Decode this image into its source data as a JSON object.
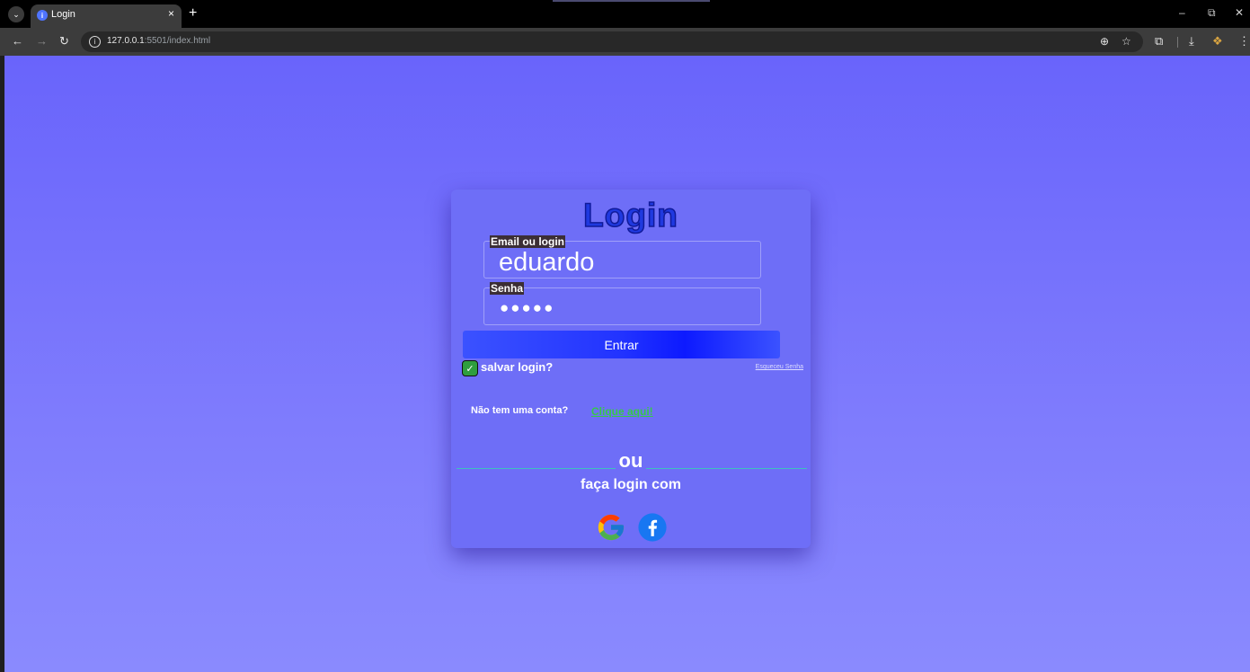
{
  "browser": {
    "tab_title": "Login",
    "tab_close": "×",
    "new_tab": "+",
    "url_host": "127.0.0.1",
    "url_rest": ":5501/index.html",
    "window_controls": {
      "minimize": "–",
      "restore": "⧉",
      "close": "✕"
    }
  },
  "login": {
    "title": "Login",
    "email_label": "Email ou login",
    "email_value": "eduardo",
    "password_label": "Senha",
    "password_value": "●●●●●",
    "submit_label": "Entrar",
    "remember_label": "salvar login?",
    "remember_checked": true,
    "forgot_label": "Esqueceu Senha",
    "no_account_text": "Não tem uma conta?",
    "signup_link": "Clique aqui!",
    "or_text": "ou",
    "login_with_text": "faça login com"
  },
  "colors": {
    "page_bg": "#7f7cfd",
    "card_bg": "#6e6ef7",
    "title": "#1f39e0",
    "button": "#2233ff",
    "checkbox": "#2f9e3f",
    "link": "#36c84a",
    "divider": "#3ec0c0"
  },
  "icons": {
    "social": [
      "google-icon",
      "facebook-icon"
    ]
  }
}
